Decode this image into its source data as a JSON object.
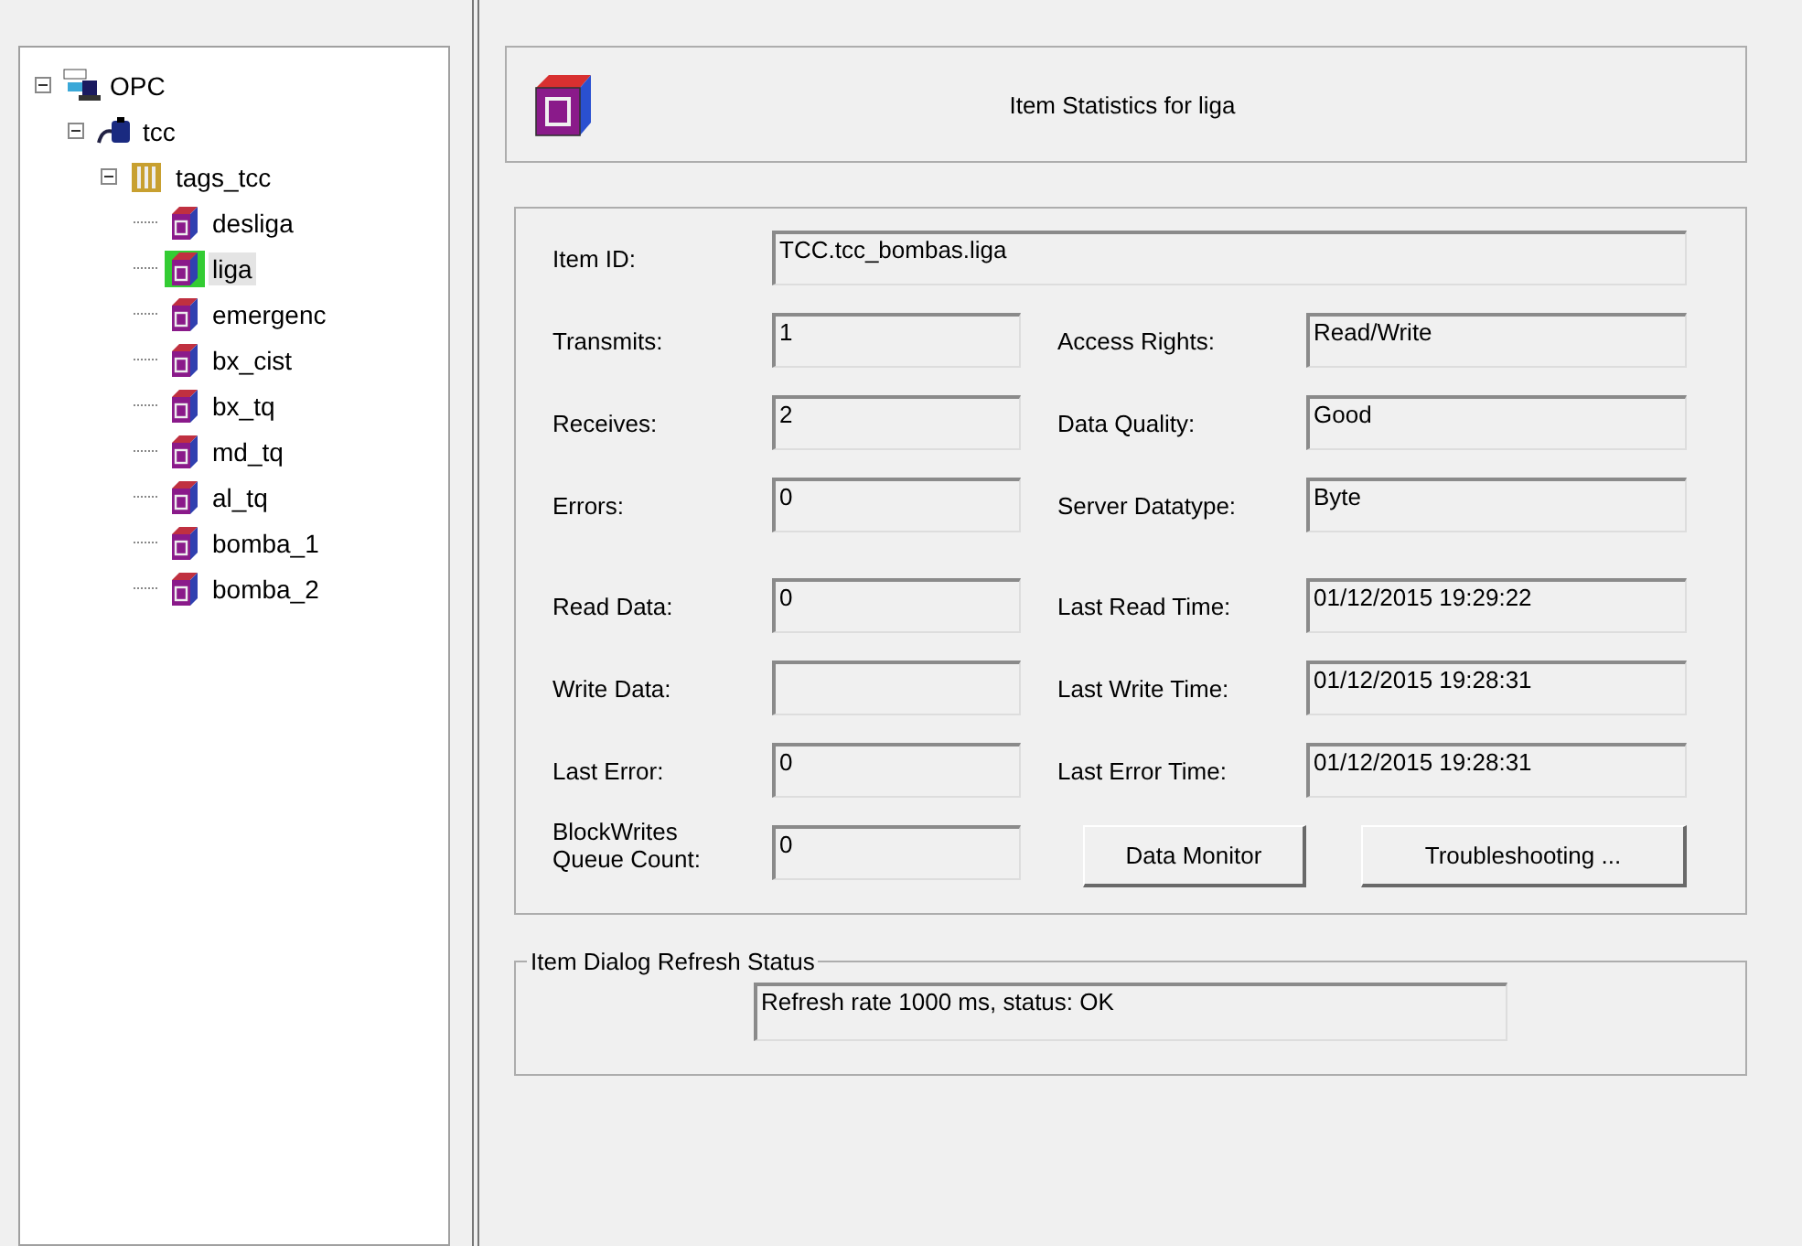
{
  "tree": [
    {
      "label": "OPC",
      "kind": "server",
      "expanded": true,
      "selected": false,
      "children": [
        {
          "label": "tcc",
          "kind": "device",
          "expanded": true,
          "selected": false,
          "children": [
            {
              "label": "tags_tcc",
              "kind": "group",
              "expanded": true,
              "selected": false,
              "children": [
                {
                  "label": "desliga",
                  "kind": "tag",
                  "selected": false
                },
                {
                  "label": "liga",
                  "kind": "tag",
                  "selected": true
                },
                {
                  "label": "emergenc",
                  "kind": "tag",
                  "selected": false
                },
                {
                  "label": "bx_cist",
                  "kind": "tag",
                  "selected": false
                },
                {
                  "label": "bx_tq",
                  "kind": "tag",
                  "selected": false
                },
                {
                  "label": "md_tq",
                  "kind": "tag",
                  "selected": false
                },
                {
                  "label": "al_tq",
                  "kind": "tag",
                  "selected": false
                },
                {
                  "label": "bomba_1",
                  "kind": "tag",
                  "selected": false
                },
                {
                  "label": "bomba_2",
                  "kind": "tag",
                  "selected": false
                }
              ]
            }
          ]
        }
      ]
    }
  ],
  "header": {
    "title": "Item Statistics for liga"
  },
  "item_id": {
    "label": "Item ID:",
    "value": "TCC.tcc_bombas.liga"
  },
  "rows": [
    {
      "left": {
        "label": "Transmits:",
        "value": "1"
      },
      "right": {
        "label": "Access Rights:",
        "value": "Read/Write"
      }
    },
    {
      "left": {
        "label": "Receives:",
        "value": "2"
      },
      "right": {
        "label": "Data Quality:",
        "value": "Good"
      }
    },
    {
      "left": {
        "label": "Errors:",
        "value": "0"
      },
      "right": {
        "label": "Server Datatype:",
        "value": "Byte"
      }
    },
    {
      "left": {
        "label": "Read Data:",
        "value": "0"
      },
      "right": {
        "label": "Last Read Time:",
        "value": "01/12/2015 19:29:22"
      }
    },
    {
      "left": {
        "label": "Write Data:"
      },
      "right": {
        "label": "Last Write Time:",
        "value": "01/12/2015 19:28:31"
      }
    },
    {
      "left": {
        "label": "Last Error:",
        "value": "0"
      },
      "right": {
        "label": "Last Error Time:",
        "value": "01/12/2015 19:28:31"
      }
    }
  ],
  "queue": {
    "label": "BlockWrites Queue Count:",
    "value": "0"
  },
  "buttons": [
    "Data Monitor",
    "Troubleshooting ..."
  ],
  "refresh": {
    "legend": "Item Dialog Refresh Status",
    "status": "Refresh rate 1000 ms, status: OK"
  }
}
